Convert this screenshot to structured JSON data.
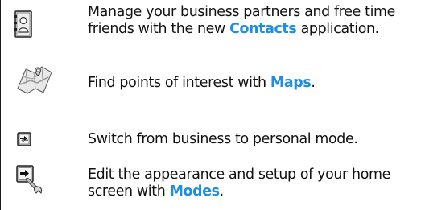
{
  "items": [
    {
      "icon": "contacts-icon",
      "line1": "Manage your business partners and free time",
      "line2_before": "friends with the new ",
      "keyword": "Contacts",
      "line2_after": " application."
    },
    {
      "icon": "maps-icon",
      "line1_before": "Find points of interest with ",
      "keyword": "Maps",
      "line1_after": "."
    },
    {
      "icon": "switch-mode-icon",
      "line1": "Switch from business to personal mode."
    },
    {
      "icon": "modes-settings-icon",
      "line1": "Edit the appearance and setup of your home",
      "line2_before": "screen with ",
      "keyword": "Modes",
      "line2_after": "."
    }
  ],
  "colors": {
    "keyword": "#1e8fe0",
    "text": "#111111"
  }
}
